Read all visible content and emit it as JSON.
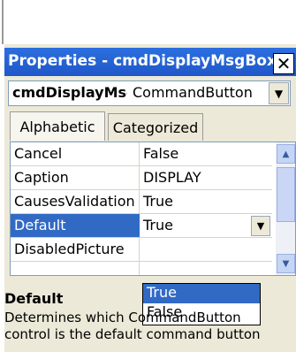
{
  "window": {
    "title": "Properties - cmdDisplayMsgBox",
    "close_glyph": "✕"
  },
  "object_selector": {
    "name": "cmdDisplayMsg",
    "type": "CommandButton"
  },
  "tabs": [
    {
      "label": "Alphabetic",
      "active": true
    },
    {
      "label": "Categorized",
      "active": false
    }
  ],
  "properties": [
    {
      "name": "Cancel",
      "value": "False"
    },
    {
      "name": "Caption",
      "value": "DISPLAY"
    },
    {
      "name": "CausesValidation",
      "value": "True"
    },
    {
      "name": "Default",
      "value": "True",
      "selected": true
    },
    {
      "name": "DisabledPicture",
      "value": ""
    }
  ],
  "dropdown": {
    "options": [
      "True",
      "False"
    ],
    "highlighted": "True"
  },
  "description": {
    "title": "Default",
    "text": "Determines which CommandButton control is the default command button"
  },
  "colors": {
    "titlebar": "#1f57c9",
    "selection": "#316ac5"
  }
}
